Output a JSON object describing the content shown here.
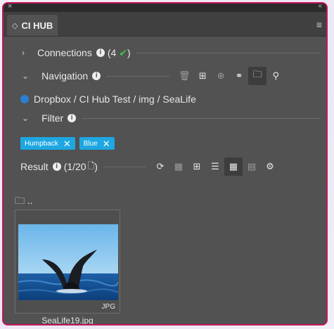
{
  "window": {
    "close_glyph": "×",
    "collapse_glyph": "«"
  },
  "tab": {
    "label": "CI HUB"
  },
  "connections": {
    "label": "Connections",
    "count_text": "(4 ",
    "check": "✔",
    "count_end": ")"
  },
  "navigation": {
    "label": "Navigation"
  },
  "breadcrumb": {
    "path": "Dropbox / CI Hub Test / img / SeaLife"
  },
  "filter": {
    "label": "Filter"
  },
  "tags": [
    {
      "label": "Humpback",
      "close": "✕"
    },
    {
      "label": "Blue",
      "close": "✕"
    }
  ],
  "result": {
    "label": "Result",
    "count": "(1/20",
    "count_end": ")"
  },
  "folder_up": {
    "label": ".."
  },
  "items": [
    {
      "ext": "JPG",
      "name": "SeaLife19.jpg"
    }
  ],
  "colors": {
    "accent_border": "#c2185b",
    "chip_blue": "#1ea7e1",
    "check_green": "#3cc24a",
    "dropbox_blue": "#2a7fd4"
  }
}
